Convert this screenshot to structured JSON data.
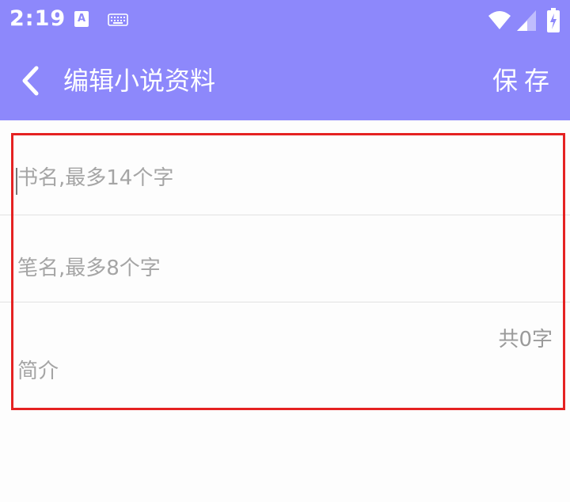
{
  "status_bar": {
    "time": "2:19",
    "notification_icons": [
      "a-icon",
      "keyboard-icon"
    ],
    "a_icon_text": "A",
    "right_icons": [
      "wifi-icon",
      "signal-icon",
      "battery-charging-icon"
    ]
  },
  "toolbar": {
    "back_icon": "chevron-left-icon",
    "title": "编辑小说资料",
    "save_label": "保存"
  },
  "form": {
    "title_placeholder": "书名,最多14个字",
    "pen_name_placeholder": "笔名,最多8个字",
    "intro_placeholder": "简介",
    "char_count": "共0字"
  },
  "colors": {
    "primary": "#8d88fb",
    "highlight": "#e52222",
    "placeholder": "#a5a5a5"
  }
}
